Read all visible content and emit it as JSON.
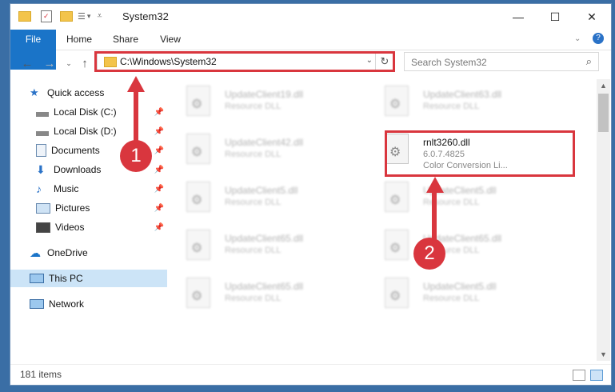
{
  "window": {
    "title": "System32"
  },
  "ribbon": {
    "tabs": [
      "File",
      "Home",
      "Share",
      "View"
    ]
  },
  "address": {
    "path": "C:\\Windows\\System32"
  },
  "search": {
    "placeholder": "Search System32"
  },
  "nav": {
    "items": [
      {
        "label": "Quick access",
        "icon": "star-icon",
        "pinned": false
      },
      {
        "label": "Local Disk (C:)",
        "icon": "drive-icon",
        "pinned": true
      },
      {
        "label": "Local Disk (D:)",
        "icon": "drive-icon",
        "pinned": true
      },
      {
        "label": "Documents",
        "icon": "documents-icon",
        "pinned": true
      },
      {
        "label": "Downloads",
        "icon": "download-icon",
        "pinned": true
      },
      {
        "label": "Music",
        "icon": "music-icon",
        "pinned": true
      },
      {
        "label": "Pictures",
        "icon": "pictures-icon",
        "pinned": true
      },
      {
        "label": "Videos",
        "icon": "videos-icon",
        "pinned": true
      },
      {
        "label": "OneDrive",
        "icon": "cloud-icon",
        "pinned": false
      },
      {
        "label": "This PC",
        "icon": "pc-icon",
        "pinned": false,
        "selected": true
      },
      {
        "label": "Network",
        "icon": "network-icon",
        "pinned": false
      }
    ]
  },
  "files": [
    {
      "name": "UpdateClient19.dll",
      "desc": "Resource DLL"
    },
    {
      "name": "UpdateClient63.dll",
      "desc": "Resource DLL"
    },
    {
      "name": "UpdateClient42.dll",
      "desc": "Resource DLL"
    },
    {
      "name": "rnlt3260.dll",
      "version": "6.0.7.4825",
      "desc": "Color Conversion Li...",
      "highlighted": true
    },
    {
      "name": "UpdateClient5.dll",
      "desc": "Resource DLL"
    },
    {
      "name": "UpdateClient5.dll",
      "desc": "Resource DLL"
    },
    {
      "name": "UpdateClient65.dll",
      "desc": "Resource DLL"
    },
    {
      "name": "UpdateClient65.dll",
      "desc": "Resource DLL"
    },
    {
      "name": "UpdateClient65.dll",
      "desc": "Resource DLL"
    },
    {
      "name": "UpdateClient5.dll",
      "desc": "Resource DLL"
    }
  ],
  "status": {
    "count": "181 items"
  },
  "annotations": {
    "step1": "1",
    "step2": "2"
  },
  "colors": {
    "accent": "#1a74c8",
    "highlight": "#d9363e",
    "selection": "#cce4f7"
  }
}
